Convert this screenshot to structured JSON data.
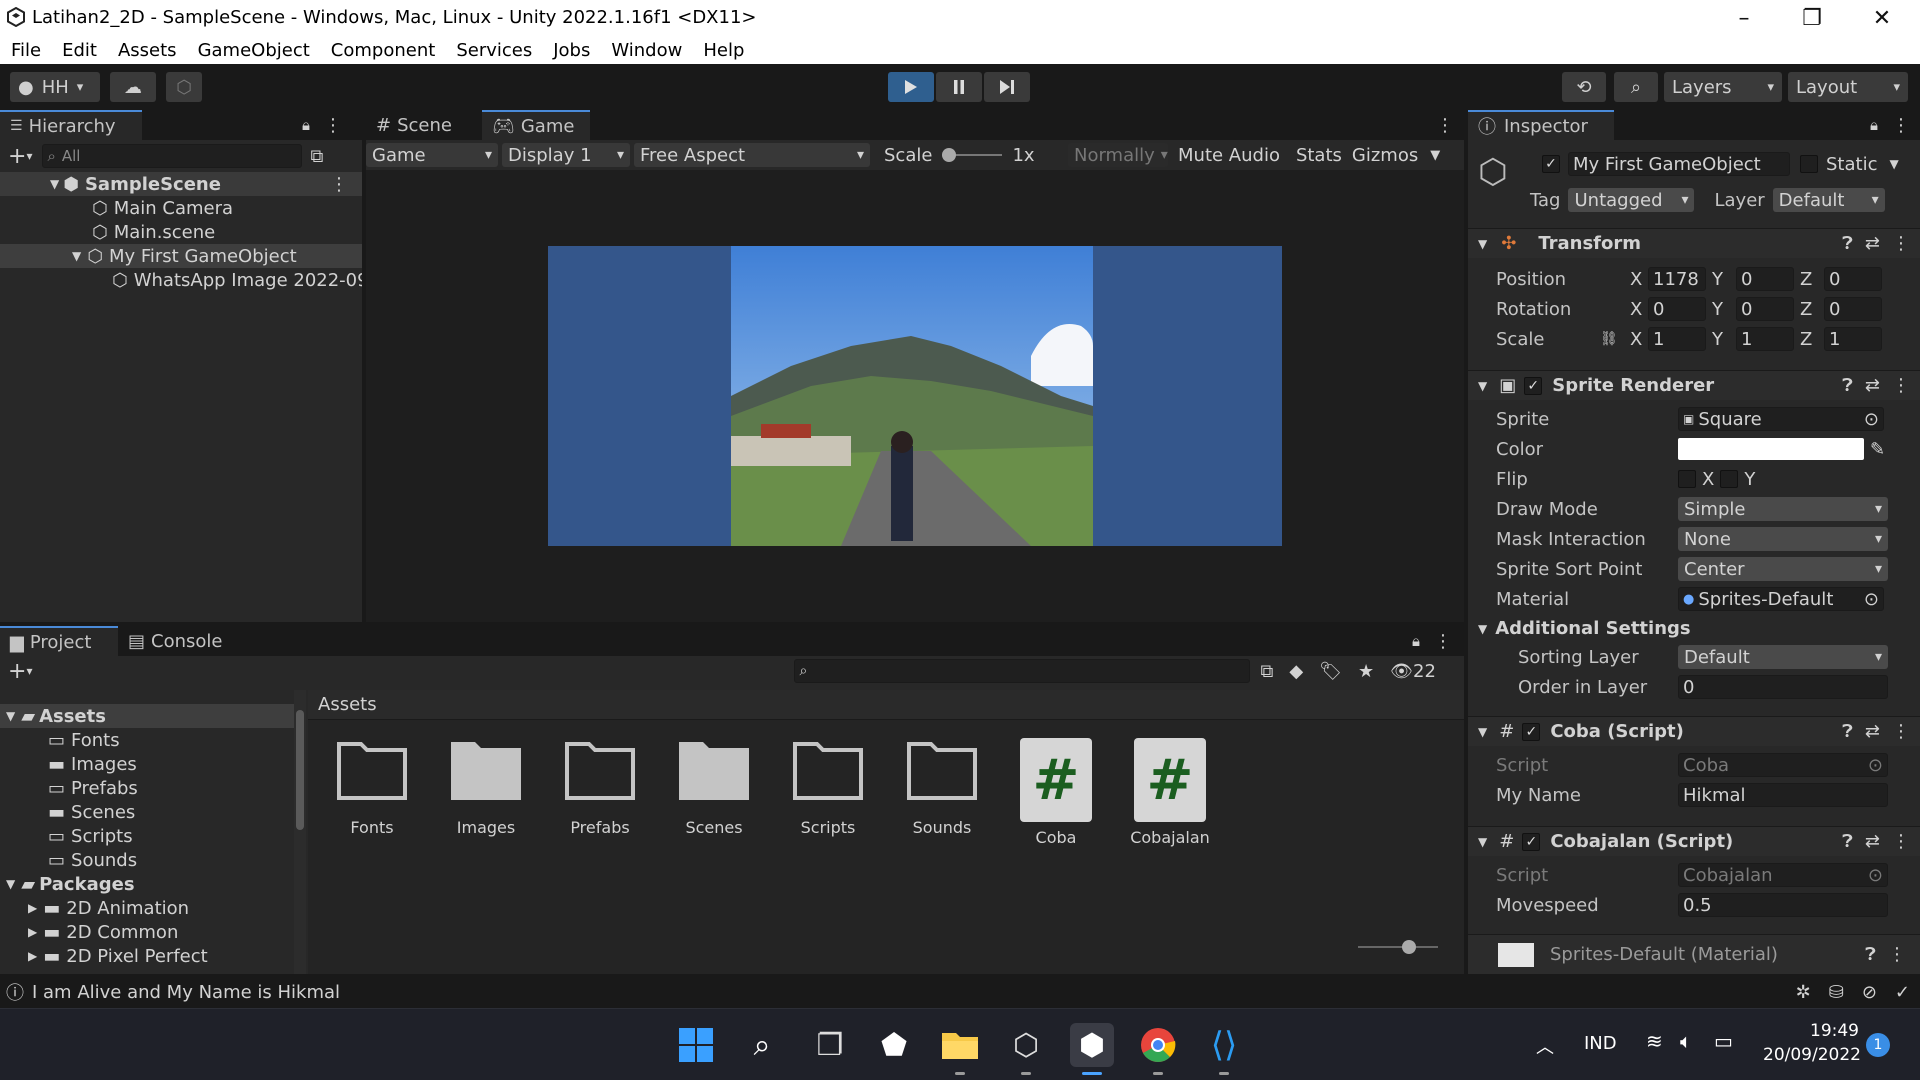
{
  "window": {
    "title": "Latihan2_2D - SampleScene - Windows, Mac, Linux - Unity 2022.1.16f1 <DX11>"
  },
  "menu": [
    "File",
    "Edit",
    "Assets",
    "GameObject",
    "Component",
    "Services",
    "Jobs",
    "Window",
    "Help"
  ],
  "toolbar": {
    "account": "HH",
    "layers": "Layers",
    "layout": "Layout"
  },
  "hierarchy": {
    "tab": "Hierarchy",
    "search_placeholder": "All",
    "scene": "SampleScene",
    "items": [
      {
        "label": "Main Camera",
        "depth": 1
      },
      {
        "label": "Main.scene",
        "depth": 1
      },
      {
        "label": "My First GameObject",
        "depth": 1
      },
      {
        "label": "WhatsApp Image 2022-09",
        "depth": 2
      }
    ]
  },
  "game": {
    "tabs": [
      "Scene",
      "Game"
    ],
    "display_mode": "Game",
    "display": "Display 1",
    "aspect": "Free Aspect",
    "scale_label": "Scale",
    "scale_value": "1x",
    "normally": "Normally",
    "mute": "Mute Audio",
    "stats": "Stats",
    "gizmos": "Gizmos",
    "bg_color": "#34568b"
  },
  "project": {
    "tabs": [
      "Project",
      "Console"
    ],
    "hidden_count": "22",
    "breadcrumb": "Assets",
    "tree": [
      {
        "label": "Assets",
        "depth": 0,
        "bold": true
      },
      {
        "label": "Fonts",
        "depth": 1
      },
      {
        "label": "Images",
        "depth": 1
      },
      {
        "label": "Prefabs",
        "depth": 1
      },
      {
        "label": "Scenes",
        "depth": 1
      },
      {
        "label": "Scripts",
        "depth": 1
      },
      {
        "label": "Sounds",
        "depth": 1
      },
      {
        "label": "Packages",
        "depth": 0,
        "bold": true
      },
      {
        "label": "2D Animation",
        "depth": 1
      },
      {
        "label": "2D Common",
        "depth": 1
      },
      {
        "label": "2D Pixel Perfect",
        "depth": 1
      }
    ],
    "assets": [
      {
        "label": "Fonts",
        "type": "folder-empty"
      },
      {
        "label": "Images",
        "type": "folder-full"
      },
      {
        "label": "Prefabs",
        "type": "folder-empty"
      },
      {
        "label": "Scenes",
        "type": "folder-full"
      },
      {
        "label": "Scripts",
        "type": "folder-empty"
      },
      {
        "label": "Sounds",
        "type": "folder-empty"
      },
      {
        "label": "Coba",
        "type": "script"
      },
      {
        "label": "Cobajalan",
        "type": "script"
      }
    ]
  },
  "inspector": {
    "tab": "Inspector",
    "object_name": "My First GameObject",
    "static_label": "Static",
    "tag_label": "Tag",
    "tag": "Untagged",
    "layer_label": "Layer",
    "layer": "Default",
    "transform": {
      "title": "Transform",
      "position": {
        "label": "Position",
        "x": "1178",
        "y": "0",
        "z": "0"
      },
      "rotation": {
        "label": "Rotation",
        "x": "0",
        "y": "0",
        "z": "0"
      },
      "scale": {
        "label": "Scale",
        "x": "1",
        "y": "1",
        "z": "1"
      }
    },
    "sprite_renderer": {
      "title": "Sprite Renderer",
      "sprite_label": "Sprite",
      "sprite": "Square",
      "color_label": "Color",
      "flip_label": "Flip",
      "flip_x": "X",
      "flip_y": "Y",
      "draw_mode_label": "Draw Mode",
      "draw_mode": "Simple",
      "mask_label": "Mask Interaction",
      "mask": "None",
      "sort_point_label": "Sprite Sort Point",
      "sort_point": "Center",
      "material_label": "Material",
      "material": "Sprites-Default",
      "additional": "Additional Settings",
      "sorting_layer_label": "Sorting Layer",
      "sorting_layer": "Default",
      "order_label": "Order in Layer",
      "order": "0"
    },
    "coba": {
      "title": "Coba (Script)",
      "script_label": "Script",
      "script": "Coba",
      "name_label": "My Name",
      "name": "Hikmal"
    },
    "cobajalan": {
      "title": "Cobajalan (Script)",
      "script_label": "Script",
      "script": "Cobajalan",
      "speed_label": "Movespeed",
      "speed": "0.5"
    },
    "material_footer": "Sprites-Default (Material)"
  },
  "status": {
    "message": "I am Alive and My Name is Hikmal"
  },
  "taskbar": {
    "lang": "IND",
    "time": "19:49",
    "date": "20/09/2022",
    "badge": "1"
  },
  "colors": {
    "accent": "#2f5f8f",
    "panel": "#282828",
    "scene_bg": "#34568b"
  }
}
